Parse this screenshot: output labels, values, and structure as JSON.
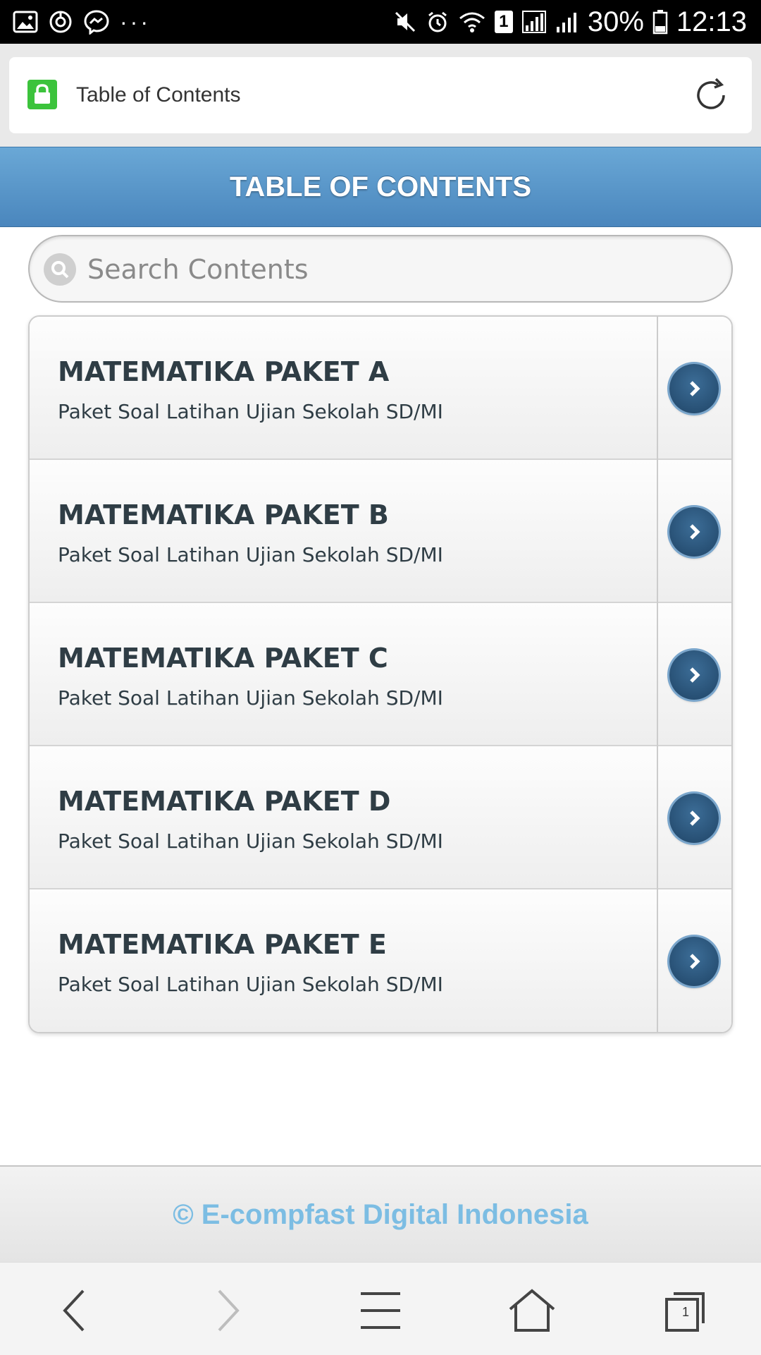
{
  "status_bar": {
    "battery": "30%",
    "time": "12:13",
    "sim_badge": "1",
    "overflow": "···"
  },
  "browser": {
    "address_title": "Table of Contents",
    "tab_count": "1"
  },
  "page": {
    "title": "TABLE OF CONTENTS",
    "search_placeholder": "Search Contents",
    "items": [
      {
        "title": "MATEMATIKA PAKET A",
        "subtitle": "Paket Soal Latihan Ujian Sekolah SD/MI"
      },
      {
        "title": "MATEMATIKA PAKET B",
        "subtitle": "Paket Soal Latihan Ujian Sekolah SD/MI"
      },
      {
        "title": "MATEMATIKA PAKET C",
        "subtitle": "Paket Soal Latihan Ujian Sekolah SD/MI"
      },
      {
        "title": "MATEMATIKA PAKET D",
        "subtitle": "Paket Soal Latihan Ujian Sekolah SD/MI"
      },
      {
        "title": "MATEMATIKA PAKET E",
        "subtitle": "Paket Soal Latihan Ujian Sekolah SD/MI"
      }
    ],
    "footer": "© E-compfast Digital Indonesia"
  },
  "colors": {
    "header_blue": "#5b97ca",
    "footer_text": "#7cbde3",
    "lock_green": "#3cc33c",
    "arrow_button": "#2a5580"
  },
  "icons": {
    "status_left": [
      "image-icon",
      "sync-icon",
      "messenger-icon"
    ],
    "status_right": [
      "mute-icon",
      "alarm-icon",
      "wifi-icon",
      "signal-icon",
      "signal-icon-2",
      "battery-icon"
    ],
    "nav": [
      "back-icon",
      "forward-icon",
      "menu-icon",
      "home-icon",
      "tabs-icon"
    ]
  }
}
